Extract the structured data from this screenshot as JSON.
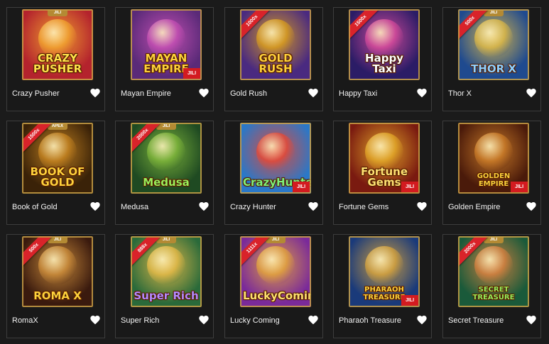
{
  "games": [
    {
      "name": "Crazy Pusher",
      "logo": "CRAZY PUSHER",
      "ribbon": "",
      "jili_top": "JILI",
      "jili_badge": "",
      "bg": "#b4232d",
      "bg2": "#f0a030",
      "logo_color": "#ffe14a"
    },
    {
      "name": "Mayan Empire",
      "logo": "MAYAN EMPIRE",
      "ribbon": "",
      "jili_top": "",
      "jili_badge": "JILI",
      "bg": "#5a2a78",
      "bg2": "#c24fb2",
      "logo_color": "#ffd13b"
    },
    {
      "name": "Gold Rush",
      "logo": "GOLD RUSH",
      "ribbon": "1000x",
      "jili_top": "",
      "jili_badge": "",
      "bg": "#4a2a80",
      "bg2": "#d59a22",
      "logo_color": "#ffd13b"
    },
    {
      "name": "Happy Taxi",
      "logo": "Happy Taxi",
      "ribbon": "1500x",
      "jili_top": "",
      "jili_badge": "",
      "bg": "#2b1c66",
      "bg2": "#d14a9a",
      "logo_color": "#ffffff"
    },
    {
      "name": "Thor X",
      "logo": "THOR X",
      "ribbon": "500x",
      "jili_top": "JILI",
      "jili_badge": "",
      "bg": "#1f4a8f",
      "bg2": "#d8b64a",
      "logo_color": "#8fd0ff"
    },
    {
      "name": "Book of Gold",
      "logo": "BOOK OF GOLD",
      "ribbon": "1500x",
      "jili_top": "APEX",
      "jili_badge": "",
      "bg": "#3a2208",
      "bg2": "#c08020",
      "logo_color": "#ffd13b"
    },
    {
      "name": "Medusa",
      "logo": "Medusa",
      "ribbon": "2000x",
      "jili_top": "JILI",
      "jili_badge": "",
      "bg": "#1f4a22",
      "bg2": "#7bb23a",
      "logo_color": "#9bf05a"
    },
    {
      "name": "Crazy Hunter",
      "logo": "CrazyHunter",
      "ribbon": "",
      "jili_top": "",
      "jili_badge": "JILI",
      "bg": "#2a78c8",
      "bg2": "#e04a3a",
      "logo_color": "#7ff07a"
    },
    {
      "name": "Fortune Gems",
      "logo": "Fortune Gems",
      "ribbon": "",
      "jili_top": "",
      "jili_badge": "JILI",
      "bg": "#7a1a10",
      "bg2": "#e0a428",
      "logo_color": "#ffe070"
    },
    {
      "name": "Golden Empire",
      "logo": "GOLDEN EMPIRE",
      "ribbon": "",
      "jili_top": "",
      "jili_badge": "JILI",
      "bg": "#4a1a0a",
      "bg2": "#c87a28",
      "logo_color": "#ffd13b"
    },
    {
      "name": "RomaX",
      "logo": "ROMA X",
      "ribbon": "500x",
      "jili_top": "JILI",
      "jili_badge": "",
      "bg": "#3a1a0e",
      "bg2": "#c88a3a",
      "logo_color": "#ffd13b"
    },
    {
      "name": "Super Rich",
      "logo": "Super Rich",
      "ribbon": "888x",
      "jili_top": "JILI",
      "jili_badge": "",
      "bg": "#2a6a3a",
      "bg2": "#e0b848",
      "logo_color": "#b48aff"
    },
    {
      "name": "Lucky Coming",
      "logo": "LuckyComing",
      "ribbon": "1111x",
      "jili_top": "JILI",
      "jili_badge": "",
      "bg": "#7a2a9a",
      "bg2": "#e0a040",
      "logo_color": "#ffe070"
    },
    {
      "name": "Pharaoh Treasure",
      "logo": "PHARAOH TREASURE",
      "ribbon": "",
      "jili_top": "",
      "jili_badge": "JILI",
      "bg": "#1a3a7a",
      "bg2": "#d0a040",
      "logo_color": "#ffd13b"
    },
    {
      "name": "Secret Treasure",
      "logo": "SECRET TREASURE",
      "ribbon": "2000x",
      "jili_top": "JILI",
      "jili_badge": "",
      "bg": "#1a5a3a",
      "bg2": "#d08040",
      "logo_color": "#9bf05a"
    }
  ]
}
